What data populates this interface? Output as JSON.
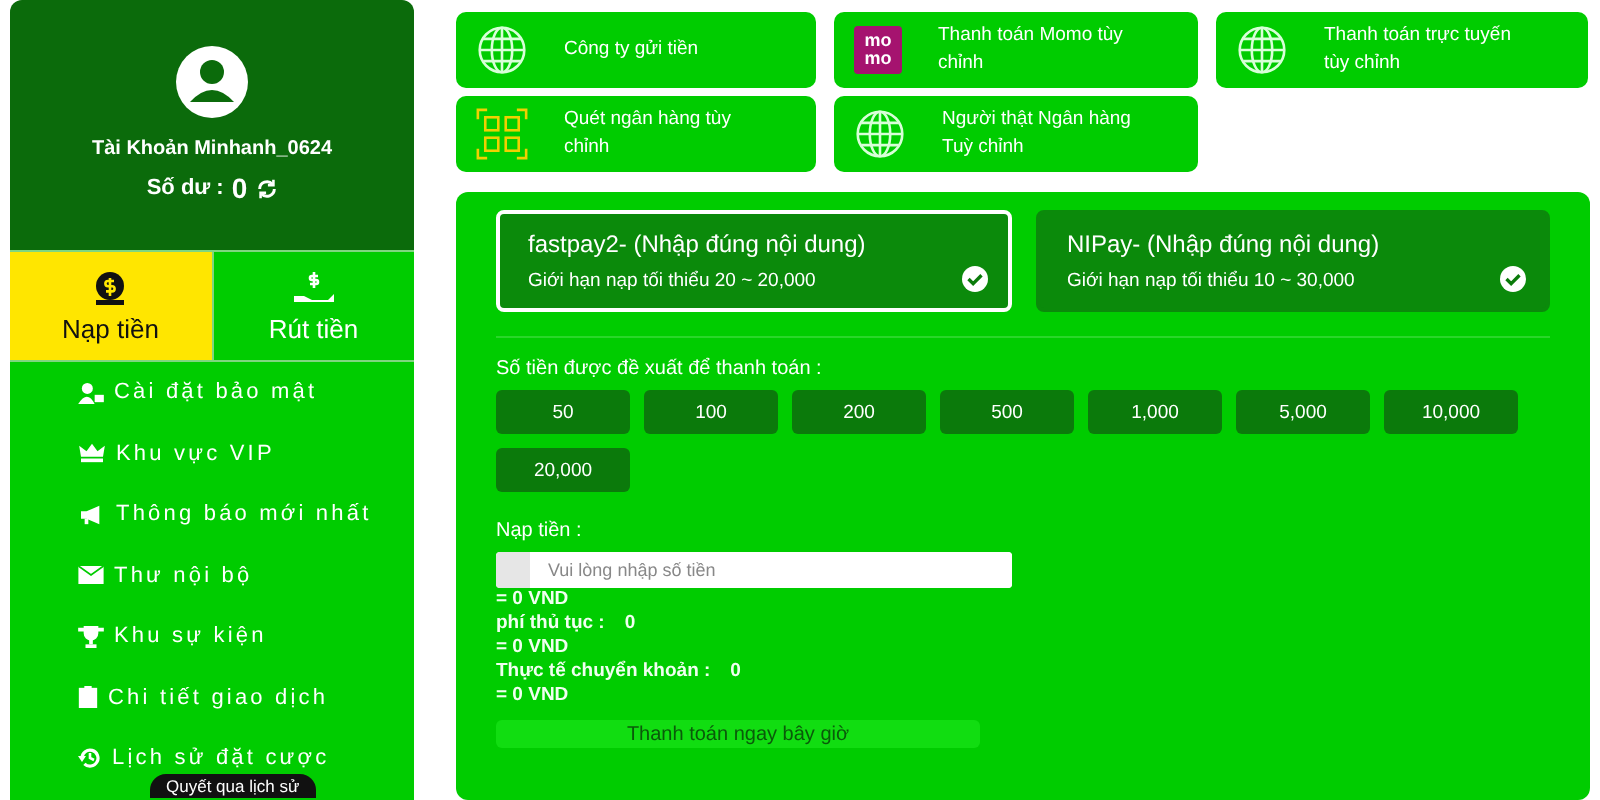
{
  "account": {
    "name": "Tài Khoản Minhanh_0624",
    "balance_label": "Số dư :",
    "balance": "0"
  },
  "actions": [
    {
      "label": "Nạp tiền",
      "kind": "deposit",
      "selected": true
    },
    {
      "label": "Rút tiền",
      "kind": "withdraw",
      "selected": false
    }
  ],
  "menu": [
    {
      "label": "Cài đặt bảo mật",
      "kind": "security"
    },
    {
      "label": "Khu vực VIP",
      "kind": "vip"
    },
    {
      "label": "Thông báo mới nhất",
      "kind": "notice"
    },
    {
      "label": "Thư nội bộ",
      "kind": "mail"
    },
    {
      "label": "Khu sự kiện",
      "kind": "event"
    },
    {
      "label": "Chi tiết giao dịch",
      "kind": "detail"
    },
    {
      "label": "Lịch sử đặt cược",
      "kind": "history"
    }
  ],
  "tooltip": "Quyết qua lịch sử",
  "methods": [
    {
      "label": "Công ty gửi tiền",
      "kind": "globe"
    },
    {
      "label": "Thanh toán Momo tùy chỉnh",
      "kind": "momo",
      "logo_lines": [
        "mo",
        "mo"
      ]
    },
    {
      "label": "Thanh toán trực tuyến tùy chỉnh",
      "kind": "globe"
    },
    {
      "label": "Quét ngân hàng tùy chỉnh",
      "kind": "qr"
    },
    {
      "label": "Người thật Ngân hàng Tuỳ chỉnh",
      "kind": "globe"
    }
  ],
  "channels": [
    {
      "name": "fastpay2-  (Nhập đúng nội dung)",
      "limit": "Giới hạn nạp tối thiểu 20 ~ 20,000",
      "selected": true
    },
    {
      "name": "NIPay-  (Nhập đúng nội dung)",
      "limit": "Giới hạn nạp tối thiểu 10 ~ 30,000",
      "selected": false
    }
  ],
  "suggest_label": "Số tiền được đề xuất để thanh toán :",
  "amounts": [
    "50",
    "100",
    "200",
    "500",
    "1,000",
    "5,000",
    "10,000",
    "20,000"
  ],
  "deposit": {
    "label": "Nạp tiền :",
    "placeholder": "Vui lòng nhập số tiền",
    "converted": "= 0 VND"
  },
  "fee": {
    "label": "phí thủ tục :",
    "value": "0",
    "converted": "= 0 VND"
  },
  "actual": {
    "label": "Thực tế chuyển khoản :",
    "value": "0",
    "converted": "= 0 VND"
  },
  "submit": "Thanh toán ngay bây giờ"
}
